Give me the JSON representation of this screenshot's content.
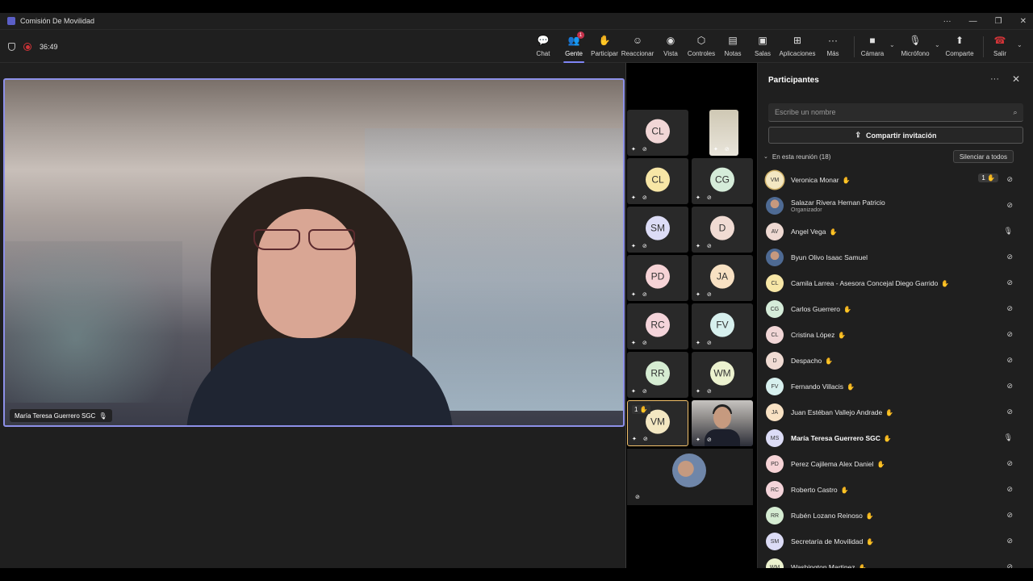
{
  "window": {
    "title": "Comisión De Movilidad",
    "controls": [
      "···",
      "—",
      "❐",
      "✕"
    ]
  },
  "toolbar": {
    "timer": "36:49",
    "buttons": [
      {
        "label": "Chat",
        "icon": "chat-icon",
        "glyph": "💬"
      },
      {
        "label": "Gente",
        "icon": "people-icon",
        "glyph": "👥",
        "badge": "1",
        "active": true
      },
      {
        "label": "Participar",
        "icon": "hand-icon",
        "glyph": "✋"
      },
      {
        "label": "Reaccionar",
        "icon": "smile-icon",
        "glyph": "☺"
      },
      {
        "label": "Vista",
        "icon": "view-icon",
        "glyph": "◉"
      },
      {
        "label": "Controles",
        "icon": "shield-icon",
        "glyph": "⬡"
      },
      {
        "label": "Notas",
        "icon": "notes-icon",
        "glyph": "▤"
      },
      {
        "label": "Salas",
        "icon": "rooms-icon",
        "glyph": "▣"
      },
      {
        "label": "Aplicaciones",
        "icon": "apps-icon",
        "glyph": "⊞"
      },
      {
        "label": "Más",
        "icon": "more-icon",
        "glyph": "···"
      },
      {
        "label": "Cámara",
        "icon": "camera-off-icon",
        "glyph": "■"
      },
      {
        "label": "Micrófono",
        "icon": "mic-off-icon",
        "glyph": "🎙"
      },
      {
        "label": "Comparte",
        "icon": "share-icon",
        "glyph": "⬆"
      },
      {
        "label": "Salir",
        "icon": "leave-icon",
        "glyph": "☎"
      }
    ]
  },
  "main_video": {
    "name": "María Teresa Guerrero SGC"
  },
  "tiles": [
    {
      "initials": "CL",
      "color": "#f1d6d6"
    },
    {
      "initials": "",
      "photo": "doc"
    },
    {
      "initials": "CL",
      "color": "#f7e6a6"
    },
    {
      "initials": "CG",
      "color": "#d5ecd9"
    },
    {
      "initials": "SM",
      "color": "#dcdcf6"
    },
    {
      "initials": "D",
      "color": "#f0dbd3"
    },
    {
      "initials": "PD",
      "color": "#f6d3d6"
    },
    {
      "initials": "JA",
      "color": "#f8e1c3"
    },
    {
      "initials": "RC",
      "color": "#f4d4da"
    },
    {
      "initials": "FV",
      "color": "#d7f0ee"
    },
    {
      "initials": "RR",
      "color": "#d5ecd2"
    },
    {
      "initials": "WM",
      "color": "#ecf2cf"
    },
    {
      "initials": "VM",
      "color": "#f3e7c2",
      "raised": "1 ✋",
      "highlight": true
    },
    {
      "initials": "",
      "photo": "man"
    }
  ],
  "panel": {
    "title": "Participantes",
    "search_placeholder": "Escribe un nombre",
    "share_label": "Compartir invitación",
    "section_label": "En esta reunión (18)",
    "mute_all_label": "Silenciar a todos",
    "participants": [
      {
        "initials": "VM",
        "name": "Veronica Monar",
        "sub": "",
        "color": "#f3e7c2",
        "raised": "1 ✋",
        "mic": "off",
        "selected": true
      },
      {
        "initials": "",
        "name": "Salazar Rivera Hernan Patricio",
        "sub": "Organizador",
        "photo": true,
        "mic": "off"
      },
      {
        "initials": "AV",
        "name": "Angel Vega",
        "sub": "",
        "color": "#efd9d2",
        "mic": "on"
      },
      {
        "initials": "",
        "name": "Byun Olivo Isaac Samuel",
        "sub": "",
        "photo": true,
        "mic": "off"
      },
      {
        "initials": "CL",
        "name": "Camila Larrea - Asesora Concejal Diego Garrido",
        "sub": "",
        "color": "#f7e6a6",
        "mic": "off"
      },
      {
        "initials": "CG",
        "name": "Carlos Guerrero",
        "sub": "",
        "color": "#d5ecd9",
        "mic": "off"
      },
      {
        "initials": "CL",
        "name": "Cristina López",
        "sub": "",
        "color": "#f1d6d6",
        "mic": "off"
      },
      {
        "initials": "D",
        "name": "Despacho",
        "sub": "",
        "color": "#f0dbd3",
        "mic": "off"
      },
      {
        "initials": "FV",
        "name": "Fernando Villacis",
        "sub": "",
        "color": "#d7f0ee",
        "mic": "off"
      },
      {
        "initials": "JA",
        "name": "Juan Estéban Vallejo Andrade",
        "sub": "",
        "color": "#f8e1c3",
        "mic": "off"
      },
      {
        "initials": "MS",
        "name": "María Teresa Guerrero SGC",
        "sub": "",
        "color": "#dcdcf6",
        "mic": "on",
        "bold": true
      },
      {
        "initials": "PD",
        "name": "Perez Cajilema Alex Daniel",
        "sub": "",
        "color": "#f6d3d6",
        "mic": "off"
      },
      {
        "initials": "RC",
        "name": "Roberto Castro",
        "sub": "",
        "color": "#f4d4da",
        "mic": "off"
      },
      {
        "initials": "RR",
        "name": "Rubén Lozano Reinoso",
        "sub": "",
        "color": "#d5ecd2",
        "mic": "off"
      },
      {
        "initials": "SM",
        "name": "Secretaría de Movilidad",
        "sub": "",
        "color": "#dcdcf6",
        "mic": "off"
      },
      {
        "initials": "WM",
        "name": "Washington Martinez",
        "sub": "",
        "color": "#ecf2cf",
        "mic": "off"
      }
    ]
  }
}
